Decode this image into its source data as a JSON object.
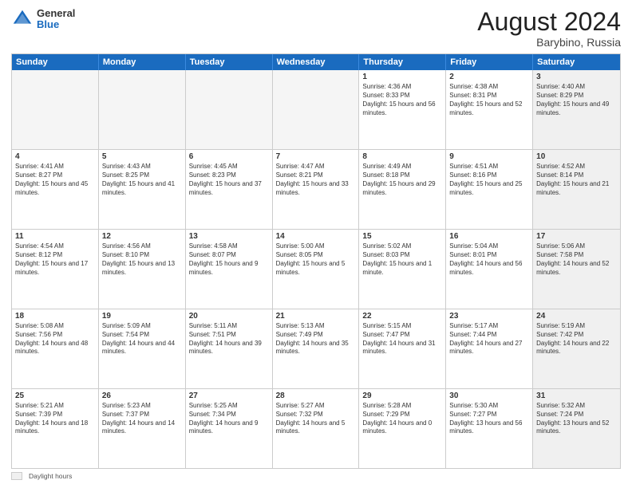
{
  "header": {
    "logo_general": "General",
    "logo_blue": "Blue",
    "month_year": "August 2024",
    "location": "Barybino, Russia"
  },
  "days_of_week": [
    "Sunday",
    "Monday",
    "Tuesday",
    "Wednesday",
    "Thursday",
    "Friday",
    "Saturday"
  ],
  "weeks": [
    [
      {
        "day": "",
        "empty": true
      },
      {
        "day": "",
        "empty": true
      },
      {
        "day": "",
        "empty": true
      },
      {
        "day": "",
        "empty": true
      },
      {
        "day": "1",
        "sunrise": "Sunrise: 4:36 AM",
        "sunset": "Sunset: 8:33 PM",
        "daylight": "Daylight: 15 hours and 56 minutes."
      },
      {
        "day": "2",
        "sunrise": "Sunrise: 4:38 AM",
        "sunset": "Sunset: 8:31 PM",
        "daylight": "Daylight: 15 hours and 52 minutes."
      },
      {
        "day": "3",
        "shaded": true,
        "sunrise": "Sunrise: 4:40 AM",
        "sunset": "Sunset: 8:29 PM",
        "daylight": "Daylight: 15 hours and 49 minutes."
      }
    ],
    [
      {
        "day": "4",
        "sunrise": "Sunrise: 4:41 AM",
        "sunset": "Sunset: 8:27 PM",
        "daylight": "Daylight: 15 hours and 45 minutes."
      },
      {
        "day": "5",
        "sunrise": "Sunrise: 4:43 AM",
        "sunset": "Sunset: 8:25 PM",
        "daylight": "Daylight: 15 hours and 41 minutes."
      },
      {
        "day": "6",
        "sunrise": "Sunrise: 4:45 AM",
        "sunset": "Sunset: 8:23 PM",
        "daylight": "Daylight: 15 hours and 37 minutes."
      },
      {
        "day": "7",
        "sunrise": "Sunrise: 4:47 AM",
        "sunset": "Sunset: 8:21 PM",
        "daylight": "Daylight: 15 hours and 33 minutes."
      },
      {
        "day": "8",
        "sunrise": "Sunrise: 4:49 AM",
        "sunset": "Sunset: 8:18 PM",
        "daylight": "Daylight: 15 hours and 29 minutes."
      },
      {
        "day": "9",
        "sunrise": "Sunrise: 4:51 AM",
        "sunset": "Sunset: 8:16 PM",
        "daylight": "Daylight: 15 hours and 25 minutes."
      },
      {
        "day": "10",
        "shaded": true,
        "sunrise": "Sunrise: 4:52 AM",
        "sunset": "Sunset: 8:14 PM",
        "daylight": "Daylight: 15 hours and 21 minutes."
      }
    ],
    [
      {
        "day": "11",
        "sunrise": "Sunrise: 4:54 AM",
        "sunset": "Sunset: 8:12 PM",
        "daylight": "Daylight: 15 hours and 17 minutes."
      },
      {
        "day": "12",
        "sunrise": "Sunrise: 4:56 AM",
        "sunset": "Sunset: 8:10 PM",
        "daylight": "Daylight: 15 hours and 13 minutes."
      },
      {
        "day": "13",
        "sunrise": "Sunrise: 4:58 AM",
        "sunset": "Sunset: 8:07 PM",
        "daylight": "Daylight: 15 hours and 9 minutes."
      },
      {
        "day": "14",
        "sunrise": "Sunrise: 5:00 AM",
        "sunset": "Sunset: 8:05 PM",
        "daylight": "Daylight: 15 hours and 5 minutes."
      },
      {
        "day": "15",
        "sunrise": "Sunrise: 5:02 AM",
        "sunset": "Sunset: 8:03 PM",
        "daylight": "Daylight: 15 hours and 1 minute."
      },
      {
        "day": "16",
        "sunrise": "Sunrise: 5:04 AM",
        "sunset": "Sunset: 8:01 PM",
        "daylight": "Daylight: 14 hours and 56 minutes."
      },
      {
        "day": "17",
        "shaded": true,
        "sunrise": "Sunrise: 5:06 AM",
        "sunset": "Sunset: 7:58 PM",
        "daylight": "Daylight: 14 hours and 52 minutes."
      }
    ],
    [
      {
        "day": "18",
        "sunrise": "Sunrise: 5:08 AM",
        "sunset": "Sunset: 7:56 PM",
        "daylight": "Daylight: 14 hours and 48 minutes."
      },
      {
        "day": "19",
        "sunrise": "Sunrise: 5:09 AM",
        "sunset": "Sunset: 7:54 PM",
        "daylight": "Daylight: 14 hours and 44 minutes."
      },
      {
        "day": "20",
        "sunrise": "Sunrise: 5:11 AM",
        "sunset": "Sunset: 7:51 PM",
        "daylight": "Daylight: 14 hours and 39 minutes."
      },
      {
        "day": "21",
        "sunrise": "Sunrise: 5:13 AM",
        "sunset": "Sunset: 7:49 PM",
        "daylight": "Daylight: 14 hours and 35 minutes."
      },
      {
        "day": "22",
        "sunrise": "Sunrise: 5:15 AM",
        "sunset": "Sunset: 7:47 PM",
        "daylight": "Daylight: 14 hours and 31 minutes."
      },
      {
        "day": "23",
        "sunrise": "Sunrise: 5:17 AM",
        "sunset": "Sunset: 7:44 PM",
        "daylight": "Daylight: 14 hours and 27 minutes."
      },
      {
        "day": "24",
        "shaded": true,
        "sunrise": "Sunrise: 5:19 AM",
        "sunset": "Sunset: 7:42 PM",
        "daylight": "Daylight: 14 hours and 22 minutes."
      }
    ],
    [
      {
        "day": "25",
        "sunrise": "Sunrise: 5:21 AM",
        "sunset": "Sunset: 7:39 PM",
        "daylight": "Daylight: 14 hours and 18 minutes."
      },
      {
        "day": "26",
        "sunrise": "Sunrise: 5:23 AM",
        "sunset": "Sunset: 7:37 PM",
        "daylight": "Daylight: 14 hours and 14 minutes."
      },
      {
        "day": "27",
        "sunrise": "Sunrise: 5:25 AM",
        "sunset": "Sunset: 7:34 PM",
        "daylight": "Daylight: 14 hours and 9 minutes."
      },
      {
        "day": "28",
        "sunrise": "Sunrise: 5:27 AM",
        "sunset": "Sunset: 7:32 PM",
        "daylight": "Daylight: 14 hours and 5 minutes."
      },
      {
        "day": "29",
        "sunrise": "Sunrise: 5:28 AM",
        "sunset": "Sunset: 7:29 PM",
        "daylight": "Daylight: 14 hours and 0 minutes."
      },
      {
        "day": "30",
        "sunrise": "Sunrise: 5:30 AM",
        "sunset": "Sunset: 7:27 PM",
        "daylight": "Daylight: 13 hours and 56 minutes."
      },
      {
        "day": "31",
        "shaded": true,
        "sunrise": "Sunrise: 5:32 AM",
        "sunset": "Sunset: 7:24 PM",
        "daylight": "Daylight: 13 hours and 52 minutes."
      }
    ]
  ],
  "footer": {
    "shaded_label": "Daylight hours"
  }
}
